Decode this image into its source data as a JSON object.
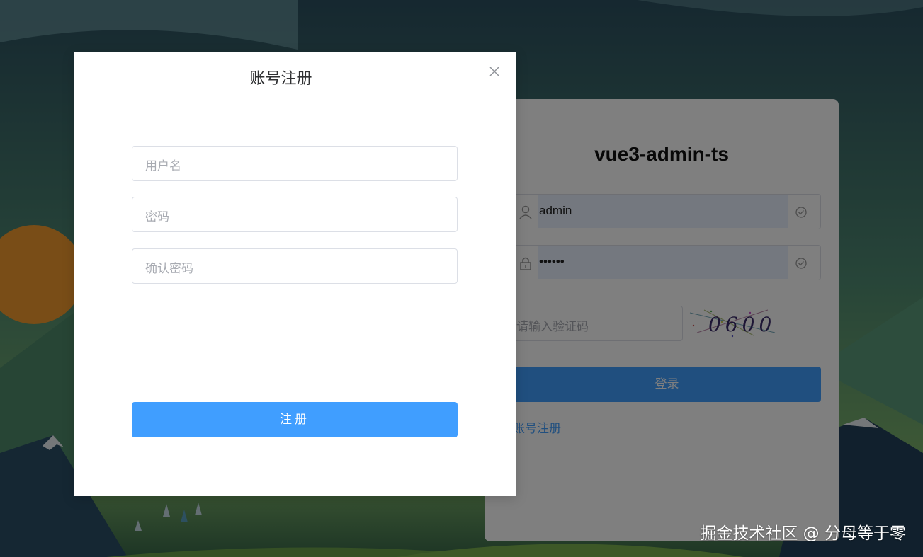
{
  "login": {
    "title": "vue3-admin-ts",
    "username_value": "admin",
    "password_value": "••••••",
    "captcha_placeholder": "请输入验证码",
    "captcha_text": "0600",
    "login_button": "登录",
    "register_link": "账号注册"
  },
  "dialog": {
    "title": "账号注册",
    "username_placeholder": "用户名",
    "password_placeholder": "密码",
    "confirm_placeholder": "确认密码",
    "submit_button": "注册"
  },
  "watermark": "掘金技术社区 @ 分母等于零",
  "colors": {
    "primary": "#409eff",
    "overlay": "rgba(0,0,0,0.5)",
    "sun": "#f29a2e"
  }
}
